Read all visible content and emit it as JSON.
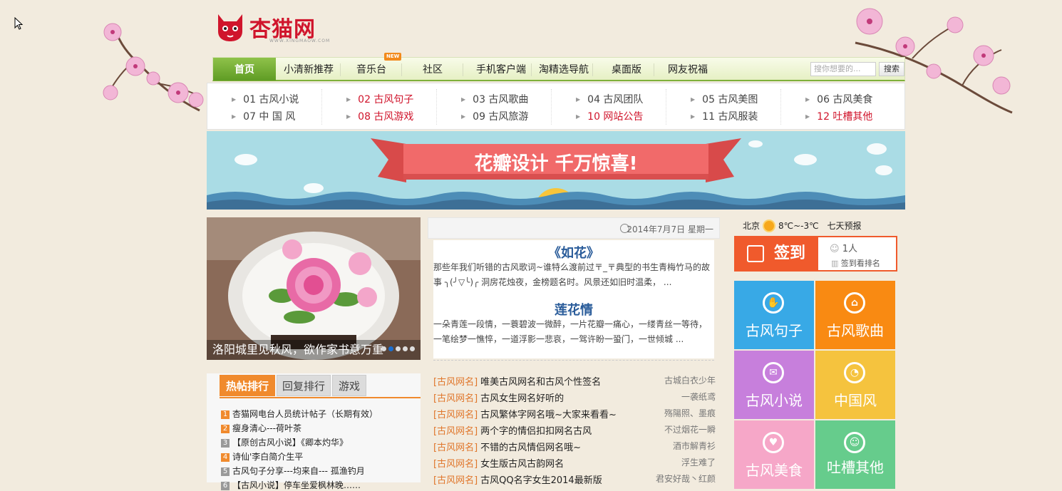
{
  "logo": {
    "name": "杏猫网",
    "sub": "WWW.XINGMAOW.COM"
  },
  "nav": {
    "items": [
      "首页",
      "小清新推荐",
      "音乐台",
      "社区",
      "手机客户端",
      "淘精选导航",
      "桌面版",
      "网友祝福"
    ],
    "new_badge": "NEW",
    "search_placeholder": "搜你想要的...",
    "search_button": "搜索"
  },
  "subnav": [
    {
      "top": "01 古风小说",
      "bottom": "07 中 国 风"
    },
    {
      "top": "02 古风句子",
      "bottom": "08 古风游戏"
    },
    {
      "top": "03 古风歌曲",
      "bottom": "09 古风旅游"
    },
    {
      "top": "04 古风团队",
      "bottom": "10 网站公告"
    },
    {
      "top": "05 古风美图",
      "bottom": "11 古风服装"
    },
    {
      "top": "06 古风美食",
      "bottom": "12 吐槽其他"
    }
  ],
  "banner": {
    "text": "花瓣设计 千万惊喜!"
  },
  "slider": {
    "caption": "洛阳城里见秋风，欲作家书意万重"
  },
  "rank": {
    "tabs": [
      "热帖排行",
      "回复排行",
      "游戏"
    ],
    "items": [
      "杏猫网电台人员统计帖子（长期有效）",
      "瘦身清心---荷叶茶",
      "【原创古风小说】《卿本灼华》",
      "诗仙'李白简介生平",
      "古风句子分享---均来自--- 孤渔钓月",
      "【古风小说】停车坐爱枫林晚……"
    ],
    "numbers": [
      "1",
      "2",
      "3",
      "4",
      "5",
      "6"
    ]
  },
  "center": {
    "date": "2014年7月7日 星期一",
    "article1": {
      "title": "《如花》",
      "body": "那些年我们听错的古风歌词~谁特么渡前过〒_〒典型的书生青梅竹马的故事 ╮(╯▽╰)╭ 洞房花烛夜，金榜题名时。风景还如旧时温柔， ..."
    },
    "article2": {
      "title": "莲花情",
      "body": "一朵青莲一段情，一蓑碧波一微醉，一片花瓣一痛心，一缕青丝一等待，一笔绘梦一憔悴，一道浮影一悲哀，一驾许盼一蛩门，一世倾城 ..."
    },
    "list": [
      {
        "tag": "[古风网名]",
        "title": "唯美古风网名和古风个性签名",
        "author": "古城白衣少年"
      },
      {
        "tag": "[古风网名]",
        "title": "古风女生网名好听的",
        "author": "一袭纸鸢"
      },
      {
        "tag": "[古风网名]",
        "title": "古风繁体字网名哦~大家来看看~",
        "author": "殇陽照、墨痕"
      },
      {
        "tag": "[古风网名]",
        "title": "两个字的情侣扣扣网名古风",
        "author": "不过烟花一瞬"
      },
      {
        "tag": "[古风网名]",
        "title": "不错的古风情侣网名哦~",
        "author": "酒市解青衫"
      },
      {
        "tag": "[古风网名]",
        "title": "女生版古风古韵网名",
        "author": "浮生难了"
      },
      {
        "tag": "[古风网名]",
        "title": "古风QQ名字女生2014最新版",
        "author": "君安好哉丶红颜"
      }
    ]
  },
  "right": {
    "weather": {
      "city": "北京",
      "temp": "8℃~-3℃",
      "forecast": "七天预报"
    },
    "signin": {
      "label": "签到",
      "count": "1人",
      "rank": "签到看排名"
    },
    "tiles": [
      {
        "label": "古风句子",
        "icon": "hand-icon",
        "color": "#38a9e6"
      },
      {
        "label": "古风歌曲",
        "icon": "home-icon",
        "color": "#f98a12"
      },
      {
        "label": "古风小说",
        "icon": "mail-icon",
        "color": "#c77fdc"
      },
      {
        "label": "中国风",
        "icon": "clock-icon",
        "color": "#f5c33e"
      },
      {
        "label": "古风美食",
        "icon": "heart-icon",
        "color": "#f6a7c8"
      },
      {
        "label": "吐槽其他",
        "icon": "user-icon",
        "color": "#66cc8c"
      }
    ]
  }
}
